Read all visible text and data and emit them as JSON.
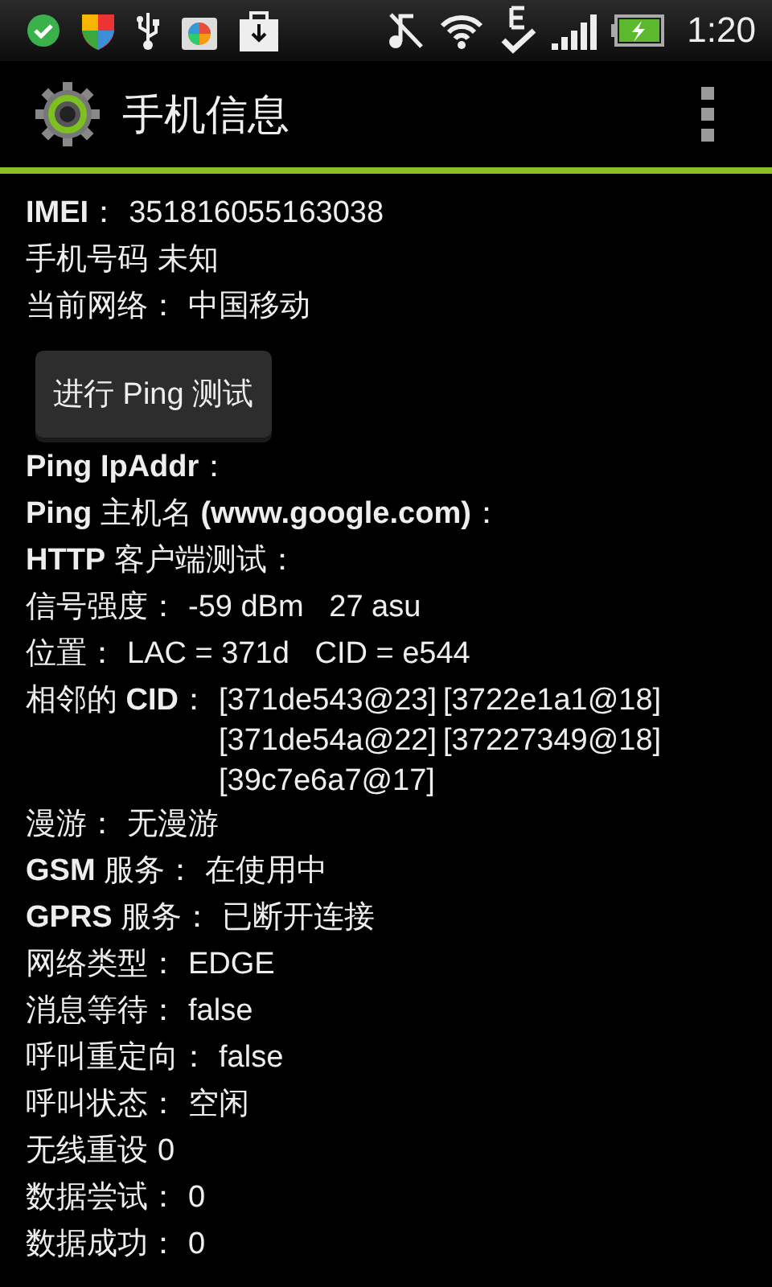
{
  "status_bar": {
    "time": "1:20"
  },
  "action_bar": {
    "title": "手机信息"
  },
  "top_rows": [
    {
      "label": "**IMEI**：",
      "value": "351816055163038"
    },
    {
      "label": "手机号码",
      "value": "未知"
    },
    {
      "label": "当前网络：",
      "value": "中国移动"
    }
  ],
  "ping_button": {
    "label": "进行 Ping 测试"
  },
  "rows": [
    {
      "kind": "text",
      "label": "**Ping IpAddr**：",
      "value": ""
    },
    {
      "kind": "text",
      "label": "**Ping** 主机名 **(www.google.com)**：",
      "value": ""
    },
    {
      "kind": "text",
      "label": "**HTTP** 客户端测试：",
      "value": ""
    },
    {
      "kind": "text",
      "label": "信号强度：",
      "value": "-59 dBm   27 asu"
    },
    {
      "kind": "text",
      "label": "位置：",
      "value": "LAC = 371d   CID = e544"
    },
    {
      "kind": "list",
      "label": "相邻的 **CID**：",
      "values": [
        "[371de543@23]",
        "[3722e1a1@18]",
        "[371de54a@22]",
        "[37227349@18]",
        "[39c7e6a7@17]"
      ]
    },
    {
      "kind": "text",
      "label": "漫游：",
      "value": "无漫游"
    },
    {
      "kind": "text",
      "label": "**GSM** 服务：",
      "value": "在使用中"
    },
    {
      "kind": "text",
      "label": "**GPRS** 服务：",
      "value": "已断开连接"
    },
    {
      "kind": "text",
      "label": "网络类型：",
      "value": "EDGE"
    },
    {
      "kind": "text",
      "label": "消息等待：",
      "value": "false"
    },
    {
      "kind": "text",
      "label": "呼叫重定向：",
      "value": "false"
    },
    {
      "kind": "text",
      "label": "呼叫状态：",
      "value": "空闲"
    },
    {
      "kind": "text",
      "label": "无线重设",
      "value": "0"
    },
    {
      "kind": "text",
      "label": "数据尝试：",
      "value": "0"
    },
    {
      "kind": "text",
      "label": "数据成功：",
      "value": "0"
    }
  ]
}
